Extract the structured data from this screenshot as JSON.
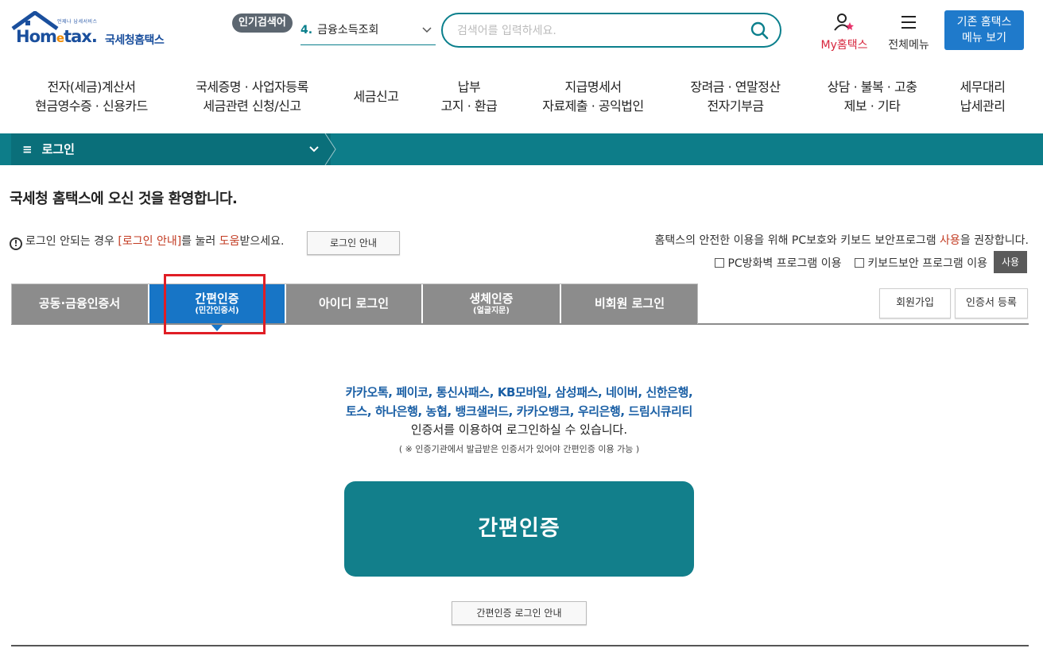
{
  "header": {
    "logo_small": "언제나 납세서비스",
    "logo_brand_pre": "Hom",
    "logo_brand_e": "e",
    "logo_brand_post": "tax.",
    "logo_kor": "국세청홈택스",
    "popular_badge": "인기검색어",
    "popular_num": "4.",
    "popular_term": "금융소득조회",
    "search_placeholder": "검색어를 입력하세요.",
    "my_hometax": "My홈택스",
    "all_menu": "전체메뉴",
    "old_menu_line1": "기존 홈택스",
    "old_menu_line2": "메뉴 보기"
  },
  "gnb": [
    {
      "line1": "전자(세금)계산서",
      "line2": "현금영수증 · 신용카드"
    },
    {
      "line1": "국세증명 · 사업자등록",
      "line2": "세금관련 신청/신고"
    },
    {
      "line1": "세금신고",
      "line2": ""
    },
    {
      "line1": "납부",
      "line2": "고지 · 환급"
    },
    {
      "line1": "지급명세서",
      "line2": "자료제출 · 공익법인"
    },
    {
      "line1": "장려금 · 연말정산",
      "line2": "전자기부금"
    },
    {
      "line1": "상담 · 불복 · 고충",
      "line2": "제보 · 기타"
    },
    {
      "line1": "세무대리",
      "line2": "납세관리"
    }
  ],
  "location": {
    "menu_label": "로그인"
  },
  "page": {
    "welcome": "국세청 홈택스에 오신 것을 환영합니다.",
    "notice_pre": "로그인 안되는 경우 ",
    "notice_link": "[로그인 안내]",
    "notice_mid": "를 눌러 ",
    "notice_help": "도움",
    "notice_post": "받으세요.",
    "guide_button": "로그인 안내",
    "sec_notice_pre": "홈택스의 안전한 이용을 위해 PC보호와 키보드 보안프로그램 ",
    "sec_notice_red": "사용",
    "sec_notice_post": "을 권장합니다.",
    "check_firewall": "PC방화벽 프로그램 이용",
    "check_keyboard": "키보드보안 프로그램 이용",
    "use_button": "사용"
  },
  "tabs": [
    {
      "main": "공동·금융인증서",
      "sub": ""
    },
    {
      "main": "간편인증",
      "sub": "(민간인증서)"
    },
    {
      "main": "아이디 로그인",
      "sub": ""
    },
    {
      "main": "생체인증",
      "sub": "(얼굴지문)"
    },
    {
      "main": "비회원 로그인",
      "sub": ""
    }
  ],
  "active_tab": 1,
  "side_buttons": {
    "join": "회원가입",
    "cert_register": "인증서 등록"
  },
  "content": {
    "providers_line1": "카카오톡, 페이코, 통신사패스, KB모바일, 삼성패스, 네이버, 신한은행,",
    "providers_line2": "토스, 하나은행, 농협, 뱅크샐러드, 카카오뱅크, 우리은행, 드림시큐리티",
    "desc": "인증서를 이용하여 로그인하실 수 있습니다.",
    "note": "( ※ 인증기관에서 발급받은 인증서가 있어야 간편인증 이용 가능 )",
    "big_button": "간편인증",
    "guide_button": "간편인증 로그인 안내"
  },
  "colors": {
    "teal": "#0d7d89",
    "active_tab": "#1775c6",
    "inactive_tab": "#8c8c8c",
    "highlight": "#e01e25"
  }
}
